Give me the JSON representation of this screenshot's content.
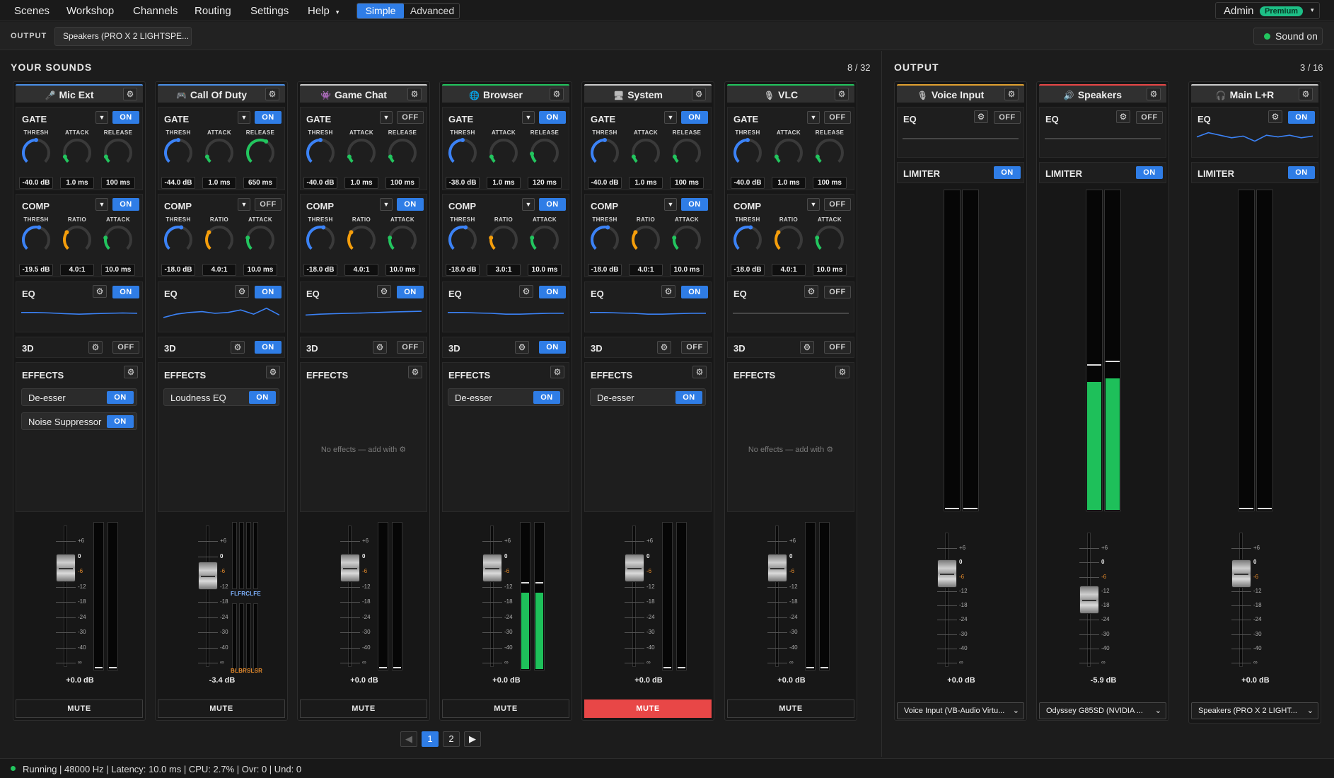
{
  "menu": {
    "items": [
      "Scenes",
      "Workshop",
      "Channels",
      "Routing",
      "Settings",
      "Help"
    ],
    "help_caret": "▾",
    "mode_simple": "Simple",
    "mode_advanced": "Advanced",
    "active_mode": "Simple"
  },
  "account": {
    "name": "Admin",
    "badge": "Premium",
    "caret": "▾"
  },
  "output_bar": {
    "label": "OUTPUT",
    "device": "Speakers (PRO X 2 LIGHTSPE...",
    "sound_label": "Sound on"
  },
  "sounds": {
    "title": "YOUR SOUNDS",
    "count": "8 / 32",
    "knob_labels": {
      "gate": [
        "THRESH",
        "ATTACK",
        "RELEASE"
      ],
      "comp": [
        "THRESH",
        "RATIO",
        "ATTACK"
      ]
    },
    "labels": {
      "gate": "GATE",
      "comp": "COMP",
      "eq": "EQ",
      "3d": "3D",
      "effects": "EFFECTS",
      "mute": "MUTE"
    },
    "channels": [
      {
        "name": "Mic Ext",
        "icon": "microphone-icon",
        "glyph": "🎤",
        "accent": "#4a8fe7",
        "gate": {
          "on": "ON",
          "thresh": "-40.0 dB",
          "attack": "1.0 ms",
          "release": "100 ms",
          "levels": [
            0.5,
            0.1,
            0.1
          ]
        },
        "comp": {
          "on": "ON",
          "thresh": "-19.5 dB",
          "ratio": "4.0:1",
          "attack": "10.0 ms",
          "levels": [
            0.55,
            0.3,
            0.2
          ]
        },
        "eq": "ON",
        "eq_shape": "flat",
        "three_d": "OFF",
        "effects": [
          {
            "name": "De-esser",
            "state": "ON"
          },
          {
            "name": "Noise Suppressor",
            "state": "ON"
          }
        ],
        "no_effects": "",
        "gain": "+0.0 dB",
        "fader": 0.75,
        "meter_left": 0,
        "meter_right": 0,
        "muted": false,
        "channel_labels": false
      },
      {
        "name": "Call Of Duty",
        "icon": "gamepad-icon",
        "glyph": "🎮",
        "accent": "#4a8fe7",
        "gate": {
          "on": "ON",
          "thresh": "-44.0 dB",
          "attack": "1.0 ms",
          "release": "650 ms",
          "levels": [
            0.5,
            0.1,
            0.6
          ]
        },
        "comp": {
          "on": "OFF",
          "thresh": "-18.0 dB",
          "ratio": "4.0:1",
          "attack": "10.0 ms",
          "levels": [
            0.55,
            0.3,
            0.2
          ]
        },
        "eq": "ON",
        "eq_shape": "wavy",
        "three_d": "ON",
        "effects": [
          {
            "name": "Loudness EQ",
            "state": "ON"
          }
        ],
        "no_effects": "",
        "gain": "-3.4 dB",
        "fader": 0.68,
        "meter_left": 0,
        "meter_right": 0,
        "muted": false,
        "channel_labels": true,
        "top_labels": [
          "FL",
          "FR",
          "C",
          "LFE"
        ],
        "bottom_labels": [
          "BL",
          "BR",
          "SL",
          "SR"
        ]
      },
      {
        "name": "Game Chat",
        "icon": "chat-icon",
        "glyph": "👾",
        "accent": "#cccccc",
        "gate": {
          "on": "OFF",
          "thresh": "-40.0 dB",
          "attack": "1.0 ms",
          "release": "100 ms",
          "levels": [
            0.5,
            0.1,
            0.1
          ]
        },
        "comp": {
          "on": "ON",
          "thresh": "-18.0 dB",
          "ratio": "4.0:1",
          "attack": "10.0 ms",
          "levels": [
            0.55,
            0.3,
            0.2
          ]
        },
        "eq": "ON",
        "eq_shape": "gentle",
        "three_d": "OFF",
        "effects": [],
        "no_effects": "No effects — add with ⚙",
        "gain": "+0.0 dB",
        "fader": 0.75,
        "meter_left": 0,
        "meter_right": 0,
        "muted": false,
        "channel_labels": false
      },
      {
        "name": "Browser",
        "icon": "globe-icon",
        "glyph": "🌐",
        "accent": "#22c55e",
        "gate": {
          "on": "ON",
          "thresh": "-38.0 dB",
          "attack": "1.0 ms",
          "release": "120 ms",
          "levels": [
            0.5,
            0.1,
            0.15
          ]
        },
        "comp": {
          "on": "ON",
          "thresh": "-18.0 dB",
          "ratio": "3.0:1",
          "attack": "10.0 ms",
          "levels": [
            0.55,
            0.2,
            0.2
          ]
        },
        "eq": "ON",
        "eq_shape": "dip",
        "three_d": "ON",
        "effects": [
          {
            "name": "De-esser",
            "state": "ON"
          }
        ],
        "no_effects": "",
        "gain": "+0.0 dB",
        "fader": 0.75,
        "meter_left": 0.52,
        "meter_right": 0.52,
        "muted": false,
        "channel_labels": false
      },
      {
        "name": "System",
        "icon": "monitor-icon",
        "glyph": "🖥",
        "accent": "#cccccc",
        "gate": {
          "on": "ON",
          "thresh": "-40.0 dB",
          "attack": "1.0 ms",
          "release": "100 ms",
          "levels": [
            0.5,
            0.1,
            0.1
          ]
        },
        "comp": {
          "on": "ON",
          "thresh": "-18.0 dB",
          "ratio": "4.0:1",
          "attack": "10.0 ms",
          "levels": [
            0.55,
            0.3,
            0.2
          ]
        },
        "eq": "ON",
        "eq_shape": "dip",
        "three_d": "OFF",
        "effects": [
          {
            "name": "De-esser",
            "state": "ON"
          }
        ],
        "no_effects": "",
        "gain": "+0.0 dB",
        "fader": 0.75,
        "meter_left": 0,
        "meter_right": 0,
        "muted": true,
        "channel_labels": false
      },
      {
        "name": "VLC",
        "icon": "vlc-icon",
        "glyph": "🎙",
        "accent": "#22c55e",
        "gate": {
          "on": "OFF",
          "thresh": "-40.0 dB",
          "attack": "1.0 ms",
          "release": "100 ms",
          "levels": [
            0.5,
            0.1,
            0.1
          ]
        },
        "comp": {
          "on": "OFF",
          "thresh": "-18.0 dB",
          "ratio": "4.0:1",
          "attack": "10.0 ms",
          "levels": [
            0.55,
            0.3,
            0.2
          ]
        },
        "eq": "OFF",
        "eq_shape": "flatgray",
        "three_d": "OFF",
        "effects": [],
        "no_effects": "No effects — add with ⚙",
        "gain": "+0.0 dB",
        "fader": 0.75,
        "meter_left": 0,
        "meter_right": 0,
        "muted": false,
        "channel_labels": false
      }
    ]
  },
  "scale_labels": [
    "+6",
    "0",
    "-6",
    "-12",
    "-18",
    "-24",
    "-30",
    "-40",
    "∞"
  ],
  "pagination": {
    "prev": "◀",
    "pages": [
      "1",
      "2"
    ],
    "active": "1",
    "next": "▶"
  },
  "outputs": {
    "title": "OUTPUT",
    "count": "3 / 16",
    "eq_label": "EQ",
    "limiter_label": "LIMITER",
    "buses": [
      {
        "name": "Voice Input",
        "icon": "microphone-icon",
        "glyph": "🎙",
        "accent": "#e0a030",
        "eq": "OFF",
        "eq_shape": "flatgray",
        "limiter": "ON",
        "gain": "+0.0 dB",
        "fader": 0.75,
        "meter_left": 0,
        "meter_right": 0,
        "device": "Voice Input (VB-Audio Virtu..."
      },
      {
        "name": "Speakers",
        "icon": "speaker-icon",
        "glyph": "🔊",
        "accent": "#e84747",
        "eq": "OFF",
        "eq_shape": "flatgray",
        "limiter": "ON",
        "gain": "-5.9 dB",
        "fader": 0.5,
        "meter_left": 0.4,
        "meter_right": 0.41,
        "device": "Odyssey G85SD (NVIDIA ..."
      },
      {
        "name": "Main L+R",
        "icon": "headphones-icon",
        "glyph": "🎧",
        "accent": "#cccccc",
        "eq": "ON",
        "eq_shape": "bumpy",
        "limiter": "ON",
        "gain": "+0.0 dB",
        "fader": 0.75,
        "meter_left": 0,
        "meter_right": 0,
        "device": "Speakers (PRO X 2 LIGHT..."
      }
    ]
  },
  "status": {
    "text": "Running | 48000 Hz | Latency: 10.0 ms | CPU: 2.7% | Ovr: 0 | Und: 0"
  },
  "colors": {
    "accent": "#2f7de6",
    "green": "#1ec05a",
    "mute_active": "#e84747",
    "knob_blue": "#3b82f6",
    "knob_orange": "#f59e0b",
    "knob_green": "#22c55e",
    "eq_line": "#3b82f6"
  }
}
